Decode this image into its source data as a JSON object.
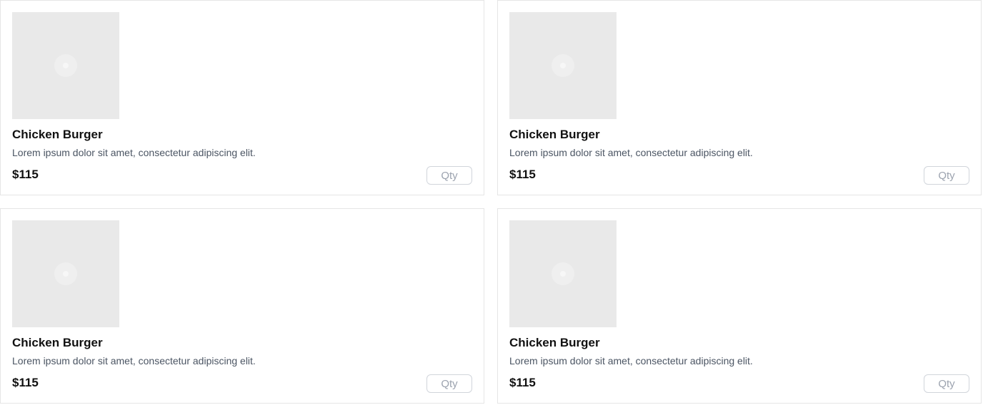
{
  "products": [
    {
      "image": "image-placeholder-icon",
      "name": "Chicken Burger",
      "description": "Lorem ipsum dolor sit amet, consectetur adipiscing elit.",
      "price": "$115",
      "qty_placeholder": "Qty",
      "qty_value": ""
    },
    {
      "image": "image-placeholder-icon",
      "name": "Chicken Burger",
      "description": "Lorem ipsum dolor sit amet, consectetur adipiscing elit.",
      "price": "$115",
      "qty_placeholder": "Qty",
      "qty_value": ""
    },
    {
      "image": "image-placeholder-icon",
      "name": "Chicken Burger",
      "description": "Lorem ipsum dolor sit amet, consectetur adipiscing elit.",
      "price": "$115",
      "qty_placeholder": "Qty",
      "qty_value": ""
    },
    {
      "image": "image-placeholder-icon",
      "name": "Chicken Burger",
      "description": "Lorem ipsum dolor sit amet, consectetur adipiscing elit.",
      "price": "$115",
      "qty_placeholder": "Qty",
      "qty_value": ""
    }
  ],
  "colors": {
    "card_border": "#e5e5e5",
    "image_placeholder": "#e9e9e9",
    "title": "#111111",
    "description": "#4b5563",
    "qty_border": "#d1d5db",
    "qty_placeholder": "#9ca3af"
  }
}
